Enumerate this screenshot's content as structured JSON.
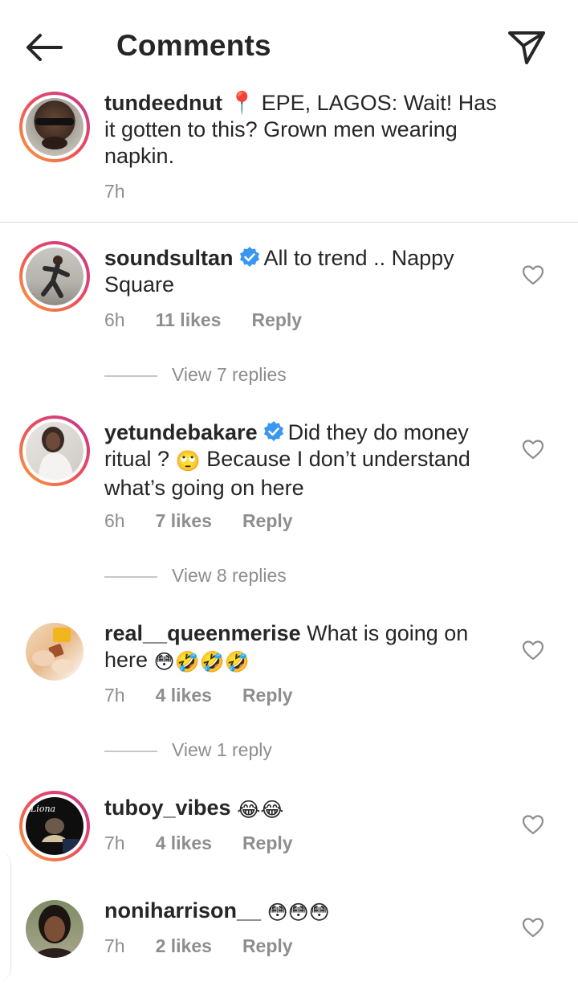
{
  "header": {
    "title": "Comments",
    "back_icon": "arrow-left-icon",
    "send_icon": "paper-plane-icon"
  },
  "caption": {
    "username": "tundeednut",
    "pin": "📍",
    "text": " EPE, LAGOS: Wait! Has it gotten to this? Grown men wearing napkin.",
    "time": "7h"
  },
  "comments": [
    {
      "username": "soundsultan",
      "verified": true,
      "text": "All to trend .. Nappy Square",
      "time": "6h",
      "likes": "11 likes",
      "reply": "Reply",
      "view_replies": "View 7 replies"
    },
    {
      "username": "yetundebakare",
      "verified": true,
      "text_before": "Did they do money ritual ? ",
      "emoji": "🙄",
      "text_after": " Because I don’t understand what’s going on here",
      "time": "6h",
      "likes": "7 likes",
      "reply": "Reply",
      "view_replies": "View 8 replies"
    },
    {
      "username": "real__queenmerise",
      "verified": false,
      "text": "What is going on here ",
      "emojis": "😳🤣🤣🤣",
      "time": "7h",
      "likes": "4 likes",
      "reply": "Reply",
      "view_replies": "View 1 reply"
    },
    {
      "username": "tuboy_vibes",
      "verified": false,
      "emojis": "😂😂",
      "time": "7h",
      "likes": "4 likes",
      "reply": "Reply"
    },
    {
      "username": "noniharrison__",
      "verified": false,
      "emojis": "😳😳😳",
      "time": "7h",
      "likes": "2 likes",
      "reply": "Reply"
    }
  ],
  "colors": {
    "text": "#262626",
    "muted": "#8e8e8e",
    "verified": "#3897f0",
    "divider": "#dbdbdb"
  }
}
